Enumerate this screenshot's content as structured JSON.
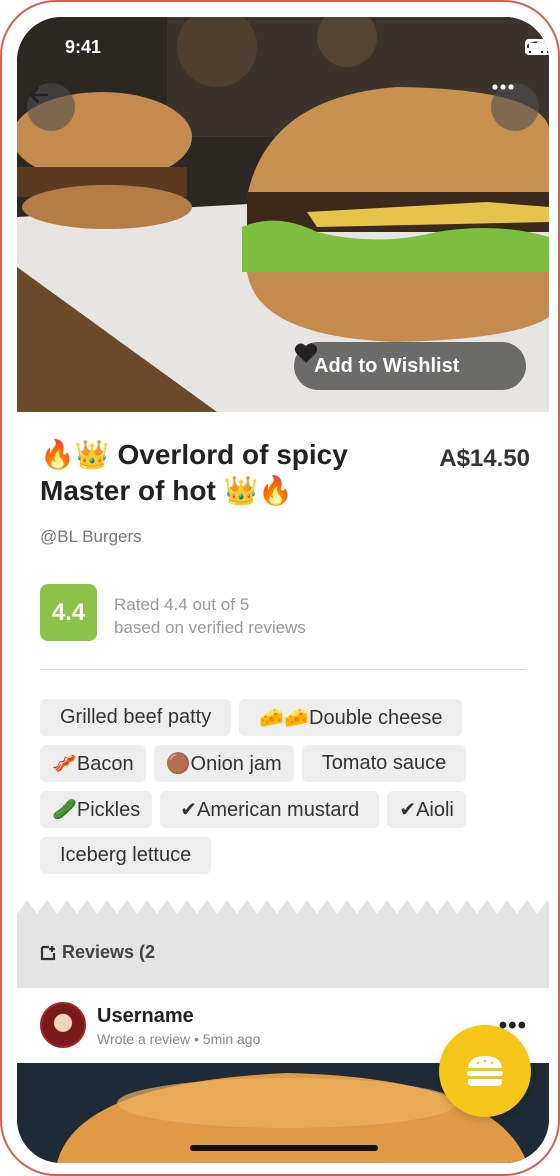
{
  "status": {
    "time": "9:41"
  },
  "hero": {
    "wishlist_label": "Add to Wishlist"
  },
  "item": {
    "title_line1": "🔥👑 Overlord of spicy",
    "title_line2": "Master of hot 👑🔥",
    "price": "A$14.50",
    "restaurant": "@BL Burgers"
  },
  "rating": {
    "score": "4.4",
    "line1": "Rated 4.4 out of 5",
    "line2": "based on verified reviews"
  },
  "ingredients": [
    [
      "Grilled beef patty",
      "🧀🧀Double cheese"
    ],
    [
      "🥓Bacon",
      "🟤Onion jam",
      "Tomato sauce"
    ],
    [
      "🥒Pickles",
      "✔American mustard",
      "✔Aioli"
    ],
    [
      "Iceberg lettuce"
    ]
  ],
  "reviews": {
    "label": "Reviews (2"
  },
  "review": {
    "username": "Username",
    "meta": "Wrote a review • 5min ago",
    "more": "•••"
  },
  "icons": [
    "back-arrow-icon",
    "more-dots-icon",
    "heart-icon",
    "reviews-icon",
    "burger-icon",
    "signal-icon",
    "wifi-icon",
    "battery-icon"
  ],
  "colors": {
    "accent": "#f5c518",
    "rating": "#8bc34a",
    "frame": "#d8604e"
  }
}
